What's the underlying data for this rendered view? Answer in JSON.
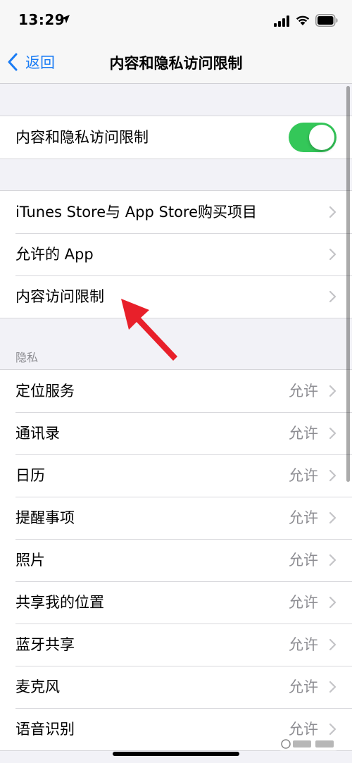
{
  "status_bar": {
    "time": "13:29",
    "icons": [
      "location-arrow-icon",
      "cellular-signal-icon",
      "wifi-icon",
      "battery-icon"
    ]
  },
  "nav": {
    "back_label": "返回",
    "title": "内容和隐私访问限制"
  },
  "main_toggle": {
    "label": "内容和隐私访问限制",
    "enabled": true
  },
  "store_group": {
    "items": [
      {
        "label": "iTunes Store与 App Store购买项目"
      },
      {
        "label": "允许的 App"
      },
      {
        "label": "内容访问限制"
      }
    ]
  },
  "privacy": {
    "header": "隐私",
    "items": [
      {
        "label": "定位服务",
        "value": "允许"
      },
      {
        "label": "通讯录",
        "value": "允许"
      },
      {
        "label": "日历",
        "value": "允许"
      },
      {
        "label": "提醒事项",
        "value": "允许"
      },
      {
        "label": "照片",
        "value": "允许"
      },
      {
        "label": "共享我的位置",
        "value": "允许"
      },
      {
        "label": "蓝牙共享",
        "value": "允许"
      },
      {
        "label": "麦克风",
        "value": "允许"
      },
      {
        "label": "语音识别",
        "value": "允许"
      }
    ]
  },
  "colors": {
    "accent": "#1a7cf5",
    "toggle_on": "#34c759",
    "annotation": "#e8202a",
    "background": "#f2f2f7",
    "secondary_text": "#8e8e93"
  }
}
